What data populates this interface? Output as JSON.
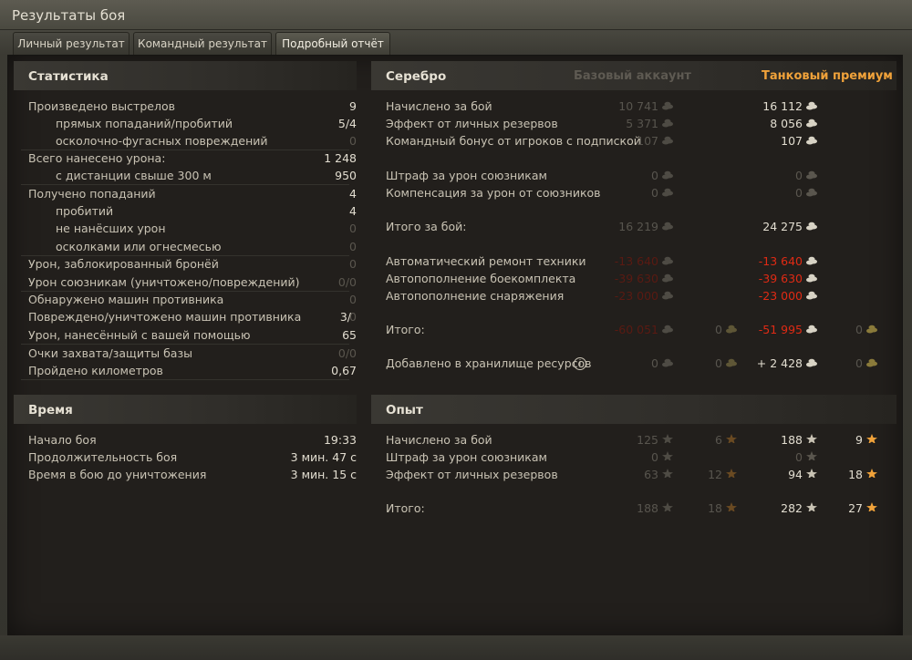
{
  "window": {
    "title": "Результаты боя"
  },
  "tabs": [
    {
      "label": "Личный результат"
    },
    {
      "label": "Командный результат"
    },
    {
      "label": "Подробный отчёт"
    }
  ],
  "stats": {
    "title": "Статистика",
    "rows": [
      {
        "label": "Произведено выстрелов",
        "value": "9"
      },
      {
        "label": "прямых попаданий/пробитий",
        "value": "5/4"
      },
      {
        "label": "осколочно-фугасных повреждений",
        "value": "0"
      },
      {
        "label": "Всего нанесено урона:",
        "value": "1 248"
      },
      {
        "label": "с дистанции свыше 300 м",
        "value": "950"
      },
      {
        "label": "Получено попаданий",
        "value": "4"
      },
      {
        "label": "пробитий",
        "value": "4"
      },
      {
        "label": "не нанёсших урон",
        "value": "0"
      },
      {
        "label": "осколками или огнесмесью",
        "value": "0"
      },
      {
        "label": "Урон, заблокированный бронёй",
        "value": "0"
      },
      {
        "label": "Урон союзникам (уничтожено/повреждений)",
        "value": "0/0"
      },
      {
        "label": "Обнаружено машин противника",
        "value": "0"
      },
      {
        "label": "Повреждено/уничтожено машин противника",
        "value_a": "3/",
        "value_b": "0"
      },
      {
        "label": "Урон, нанесённый с вашей помощью",
        "value": "65"
      },
      {
        "label": "Очки захвата/защиты базы",
        "value": "0/0"
      },
      {
        "label": "Пройдено километров",
        "value": "0,67"
      }
    ]
  },
  "time": {
    "title": "Время",
    "rows": [
      {
        "label": "Начало боя",
        "value": "19:33"
      },
      {
        "label": "Продолжительность боя",
        "value": "3 мин. 47 с"
      },
      {
        "label": "Время в бою до уничтожения",
        "value": "3 мин. 15 с"
      }
    ]
  },
  "silver": {
    "title": "Серебро",
    "col_base": "Базовый аккаунт",
    "col_premium": "Танковый премиум",
    "rows": [
      {
        "label": "Начислено за бой",
        "base": "10 741",
        "prem": "16 112"
      },
      {
        "label": "Эффект от личных резервов",
        "base": "5 371",
        "prem": "8 056"
      },
      {
        "label": "Командный бонус от игроков с подпиской",
        "base": "107",
        "prem": "107"
      },
      {
        "label": "Штраф за урон союзникам",
        "base": "0",
        "prem": "0"
      },
      {
        "label": "Компенсация за урон от союзников",
        "base": "0",
        "prem": "0"
      },
      {
        "label": "Итого за бой:",
        "base": "16 219",
        "prem": "24 275"
      },
      {
        "label": "Автоматический ремонт техники",
        "base": "-13 640",
        "prem": "-13 640"
      },
      {
        "label": "Автопополнение боекомплекта",
        "base": "-39 630",
        "prem": "-39 630"
      },
      {
        "label": "Автопополнение снаряжения",
        "base": "-23 000",
        "prem": "-23 000"
      },
      {
        "label": "Итого:",
        "base": "-60 051",
        "base_gold": "0",
        "prem": "-51 995",
        "prem_gold": "0"
      },
      {
        "label": "Добавлено в хранилище ресурсов",
        "base": "0",
        "base_gold": "0",
        "prem": "+ 2 428",
        "prem_gold": "0"
      }
    ]
  },
  "exp": {
    "title": "Опыт",
    "rows": [
      {
        "label": "Начислено за бой",
        "base": "125",
        "base_free": "6",
        "prem": "188",
        "prem_free": "9"
      },
      {
        "label": "Штраф за урон союзникам",
        "base": "0",
        "prem": "0"
      },
      {
        "label": "Эффект от личных резервов",
        "base": "63",
        "base_free": "12",
        "prem": "94",
        "prem_free": "18"
      },
      {
        "label": "Итого:",
        "base": "188",
        "base_free": "18",
        "prem": "282",
        "prem_free": "27"
      }
    ]
  },
  "colors": {
    "premium_header": "#f0a23a",
    "base_header": "#5e5a52",
    "negative": "#e02a14"
  }
}
